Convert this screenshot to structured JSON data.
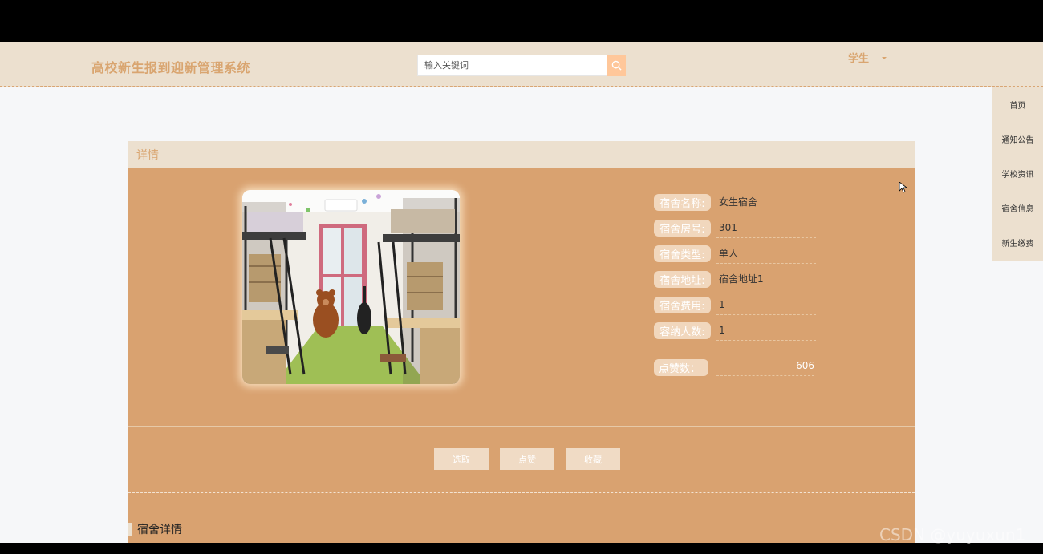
{
  "header": {
    "site_title": "高校新生报到迎新管理系统",
    "search_placeholder": "输入关键词",
    "user_label": "学生"
  },
  "side_nav": {
    "items": [
      {
        "label": "首页"
      },
      {
        "label": "通知公告"
      },
      {
        "label": "学校资讯"
      },
      {
        "label": "宿舍信息"
      },
      {
        "label": "新生缴费"
      }
    ]
  },
  "detail": {
    "panel_title": "详情",
    "fields": [
      {
        "label": "宿舍名称:",
        "value": "女生宿舍"
      },
      {
        "label": "宿舍房号:",
        "value": "301"
      },
      {
        "label": "宿舍类型:",
        "value": "单人"
      },
      {
        "label": "宿舍地址:",
        "value": "宿舍地址1"
      },
      {
        "label": "宿舍费用:",
        "value": "1"
      },
      {
        "label": "容纳人数:",
        "value": "1"
      }
    ],
    "like_label": "点赞数：",
    "like_value": "606",
    "buttons": {
      "select": "选取",
      "like": "点赞",
      "favorite": "收藏"
    },
    "section_title": "宿舍详情"
  },
  "watermark": "CSDN @yuyuxun1",
  "colors": {
    "accent": "#d9a270",
    "header_bg": "#ece0cf",
    "title_text": "#d9a570"
  }
}
